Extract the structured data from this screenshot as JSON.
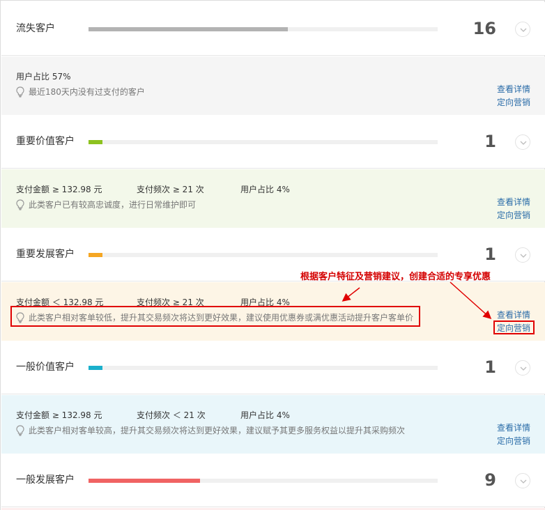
{
  "segments": [
    {
      "name": "流失客户",
      "count": "16",
      "bar_fraction": 0.57,
      "bar_color": "#b3b3b3",
      "detail_bg": "#f5f5f5",
      "metrics": {
        "user_share": "用户占比 57%"
      },
      "hint": "最近180天内没有过支付的客户",
      "links": {
        "detail": "查看详情",
        "marketing": "定向营销"
      }
    },
    {
      "name": "重要价值客户",
      "count": "1",
      "bar_fraction": 0.04,
      "bar_color": "#8dc21f",
      "detail_bg": "#f3f8ea",
      "metrics": {
        "amount": "支付金额 ≥ 132.98 元",
        "frequency": "支付频次 ≥ 21 次",
        "user_share": "用户占比 4%"
      },
      "hint": "此类客户已有较高忠诚度，进行日常维护即可",
      "links": {
        "detail": "查看详情",
        "marketing": "定向营销"
      }
    },
    {
      "name": "重要发展客户",
      "count": "1",
      "bar_fraction": 0.04,
      "bar_color": "#f5a623",
      "detail_bg": "#fdf5e6",
      "metrics": {
        "amount": "支付金额 ＜ 132.98 元",
        "frequency": "支付频次 ≥ 21 次",
        "user_share": "用户占比 4%"
      },
      "hint": "此类客户相对客单较低，提升其交易频次将达到更好效果，建议使用优惠券或满优惠活动提升客户客单价",
      "links": {
        "detail": "查看详情",
        "marketing": "定向营销"
      }
    },
    {
      "name": "一般价值客户",
      "count": "1",
      "bar_fraction": 0.04,
      "bar_color": "#1ab0cc",
      "detail_bg": "#e9f6fa",
      "metrics": {
        "amount": "支付金额 ≥ 132.98 元",
        "frequency": "支付频次 ＜ 21 次",
        "user_share": "用户占比 4%"
      },
      "hint": "此类客户相对客单较高，提升其交易频次将达到更好效果，建议赋予其更多服务权益以提升其采购频次",
      "links": {
        "detail": "查看详情",
        "marketing": "定向营销"
      }
    },
    {
      "name": "一般发展客户",
      "count": "9",
      "bar_fraction": 0.32,
      "bar_color": "#f06363",
      "detail_bg": "#fdeeee"
    }
  ],
  "annotation": {
    "text": "根据客户特征及营销建议，创建合适的专享优惠",
    "color": "#e00000"
  }
}
